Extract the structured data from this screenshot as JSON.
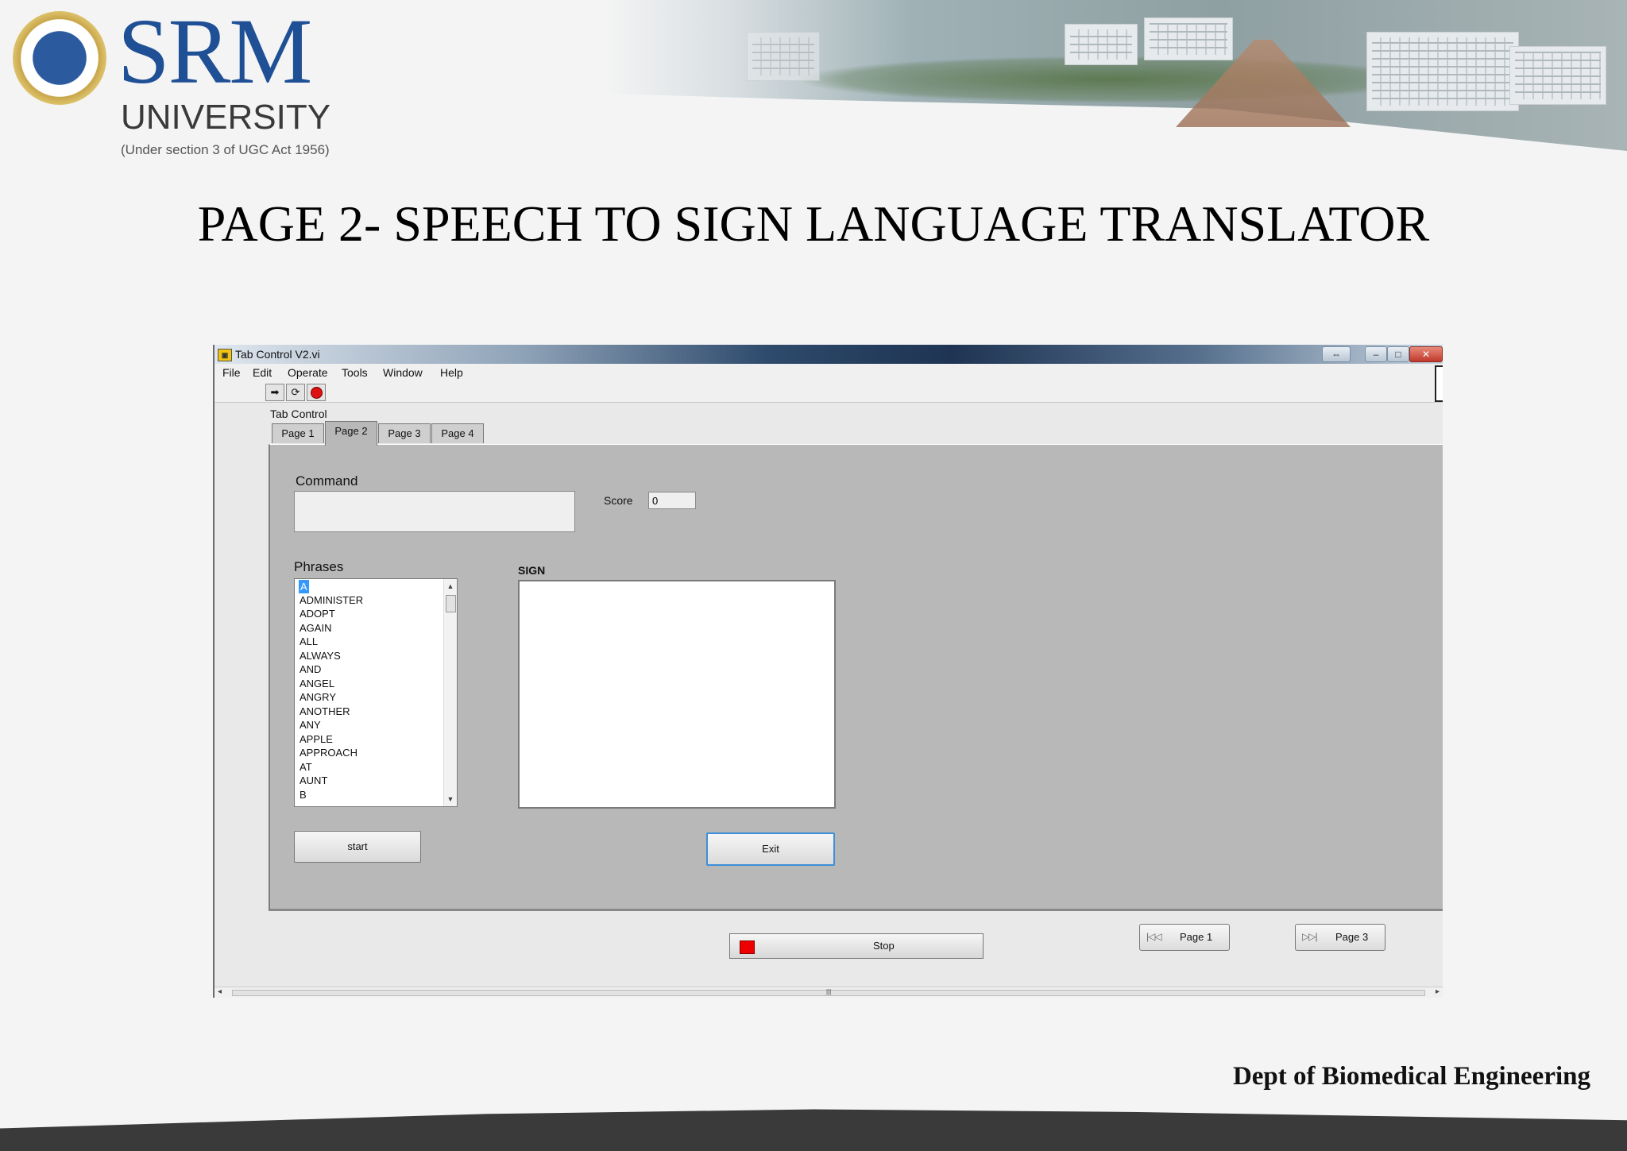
{
  "slide": {
    "logo_name": "SRM",
    "logo_university": "UNIVERSITY",
    "logo_subtitle": "(Under section 3 of UGC Act 1956)",
    "title": "PAGE 2- SPEECH TO SIGN LANGUAGE TRANSLATOR",
    "footer": "Dept of Biomedical Engineering"
  },
  "window": {
    "title": "Tab Control V2.vi",
    "app_icon": "labview-icon",
    "controls": {
      "restore": "⇔",
      "minimize": "–",
      "maximize": "□",
      "close": "✕"
    }
  },
  "menu": [
    "File",
    "Edit",
    "Operate",
    "Tools",
    "Window",
    "Help"
  ],
  "toolbar": {
    "run": "➡",
    "run_continuous": "⟳",
    "abort": "stop-icon"
  },
  "tab_control": {
    "label": "Tab Control",
    "tabs": [
      "Page 1",
      "Page 2",
      "Page 3",
      "Page 4"
    ],
    "active_tab": "Page 2"
  },
  "panel": {
    "command_label": "Command",
    "command_value": "",
    "score_label": "Score",
    "score_value": "0",
    "phrases_label": "Phrases",
    "phrases": [
      "A",
      "ADMINISTER",
      "ADOPT",
      "AGAIN",
      "ALL",
      "ALWAYS",
      "AND",
      "ANGEL",
      "ANGRY",
      "ANOTHER",
      "ANY",
      "APPLE",
      "APPROACH",
      "AT",
      "AUNT",
      "B"
    ],
    "selected_phrase": "A",
    "sign_label": "SIGN",
    "start_button": "start",
    "exit_button": "Exit"
  },
  "footer_controls": {
    "stop_button": "Stop",
    "prev_page_button": "Page 1",
    "next_page_button": "Page 3",
    "prev_icon": "|◁◁",
    "next_icon": "▷▷|"
  },
  "colors": {
    "brand_blue": "#1f4f95",
    "panel_gray": "#b8b8b9",
    "stop_red": "#e00000",
    "selection_blue": "#3399ff"
  }
}
